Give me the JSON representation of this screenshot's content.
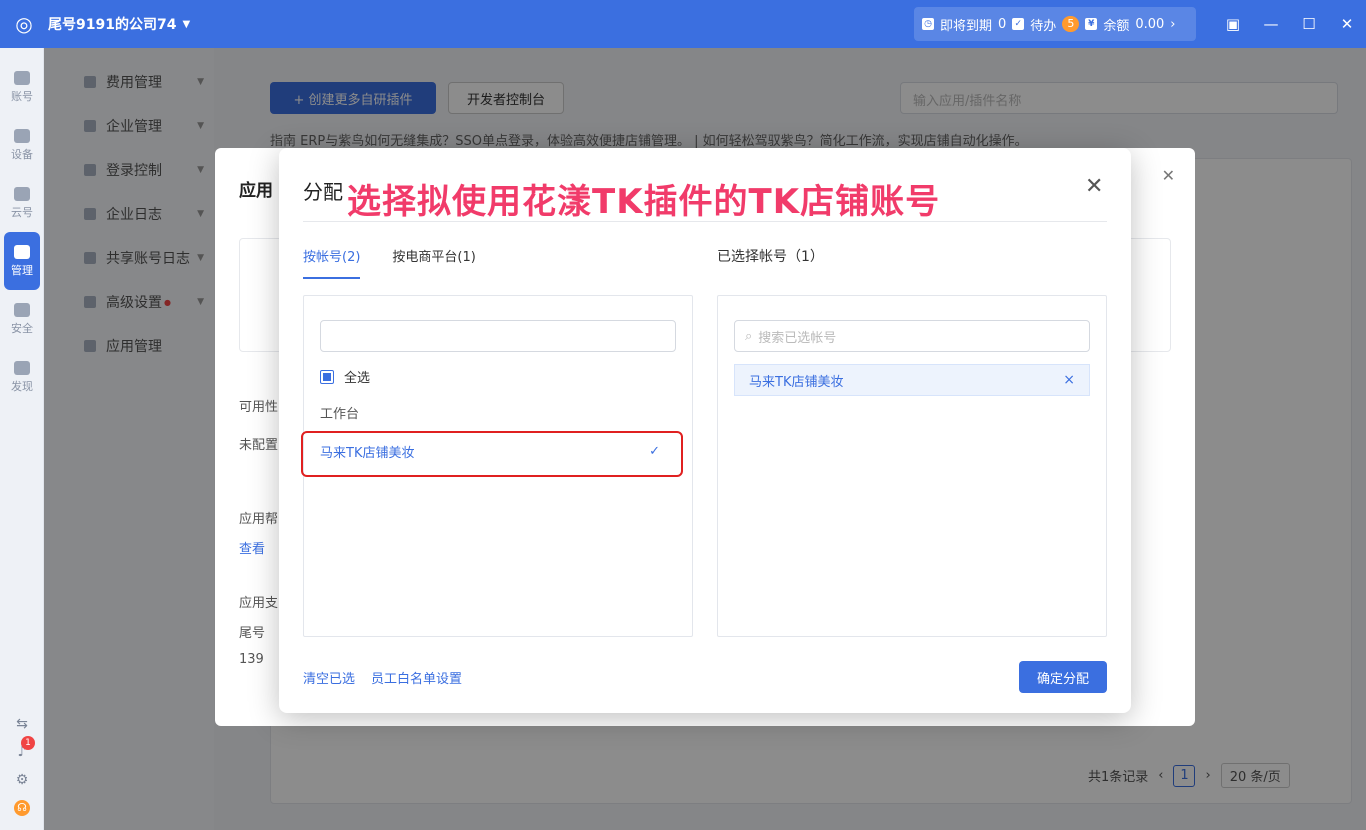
{
  "titlebar": {
    "company": "尾号9191的公司74",
    "expiring_label": "即将到期",
    "expiring_count": "0",
    "todo_label": "待办",
    "todo_count": "5",
    "balance_label": "余额",
    "balance_value": "0.00"
  },
  "rail": {
    "items": [
      "账号",
      "设备",
      "云号",
      "管理",
      "安全",
      "发现"
    ],
    "notification_count": "1"
  },
  "sidebar": {
    "items": [
      "费用管理",
      "企业管理",
      "登录控制",
      "企业日志",
      "共享账号日志",
      "高级设置",
      "应用管理"
    ]
  },
  "main": {
    "create_button": "+ 创建更多自研插件",
    "dev_console_button": "开发者控制台",
    "search_placeholder": "输入应用/插件名称",
    "guide_text": "指南  ERP与紫鸟如何无缝集成？SSO单点登录，体验高效便捷店铺管理。  |  如何轻松驾驭紫鸟？简化工作流，实现店铺自动化操作。",
    "record_count": "共1条记录",
    "page": "1",
    "page_size": "20 条/页"
  },
  "under_modal": {
    "title": "应用",
    "lines": [
      "可用性",
      "未配置",
      "应用帮",
      "查看",
      "应用支",
      "尾号",
      "139"
    ]
  },
  "modal": {
    "title": "分配",
    "annotation": "选择拟使用花漾TK插件的TK店铺账号",
    "tabs": [
      "按帐号(2)",
      "按电商平台(1)"
    ],
    "right_title": "已选择帐号（1）",
    "left_search_value": "",
    "check_all_label": "全选",
    "group_label": "工作台",
    "account_name": "马来TK店铺美妆",
    "right_search_placeholder": "搜索已选帐号",
    "selected_account": "马来TK店铺美妆",
    "clear_link": "清空已选",
    "whitelist_link": "员工白名单设置",
    "confirm_button": "确定分配"
  },
  "colors": {
    "primary": "#3b6fe0",
    "annotation": "#f13b6a",
    "highlight_box": "#e02020"
  }
}
